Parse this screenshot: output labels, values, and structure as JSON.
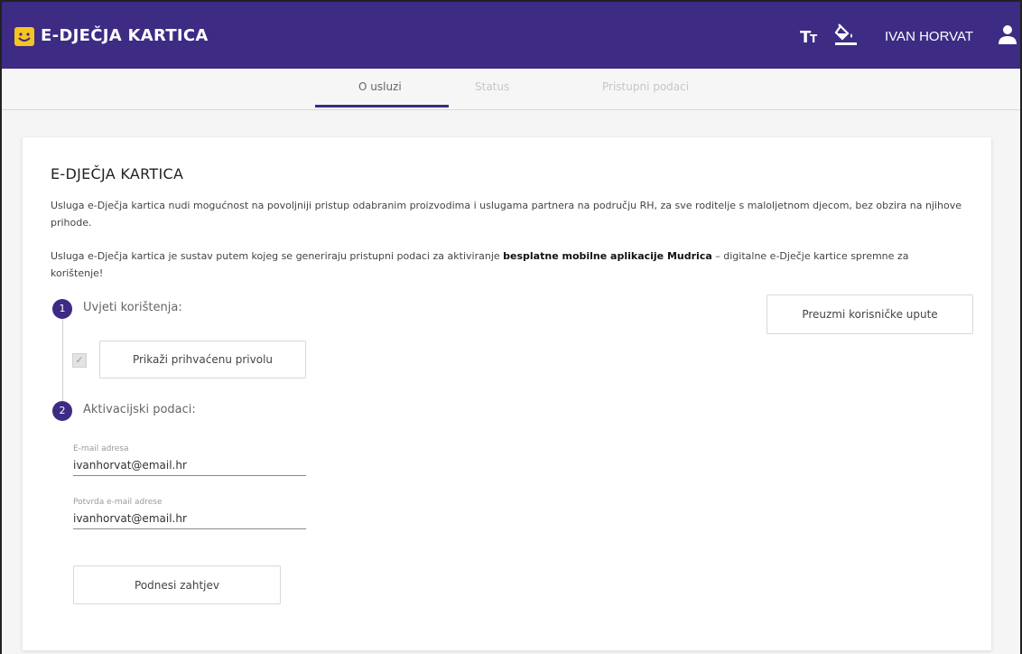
{
  "header": {
    "app_title": "E-DJEČJA KARTICA",
    "user_name": "IVAN HORVAT",
    "icons": [
      "logo-icon",
      "text-size-icon",
      "contrast-paint-icon",
      "user-icon"
    ],
    "brand_color": "#3d2b84",
    "logo_color": "#f6c51f"
  },
  "tabs": [
    {
      "label": "O usluzi",
      "active": true
    },
    {
      "label": "Status",
      "active": false
    },
    {
      "label": "Pristupni podaci",
      "active": false
    }
  ],
  "card": {
    "title": "E-DJEČJA KARTICA",
    "paragraph_1": "Usluga e-Dječja kartica nudi mogućnost na povoljniji pristup odabranim proizvodima i uslugama partnera na području RH, za sve roditelje s maloljetnom djecom, bez obzira na njihove prihode.",
    "paragraph_2_before": "Usluga e-Dječja kartica je sustav putem kojeg se generiraju pristupni podaci za aktiviranje ",
    "paragraph_2_bold": "besplatne mobilne aplikacije Mudrica",
    "paragraph_2_after": " – digitalne e-Dječje kartice spremne za korištenje!",
    "manual_button": "Preuzmi korisničke upute",
    "step_1": {
      "number": "1",
      "label": "Uvjeti korištenja:"
    },
    "consent_button": "Prikaži prihvaćenu privolu",
    "consent_checked": true,
    "step_2": {
      "number": "2",
      "label": "Aktivacijski podaci:"
    },
    "email_label": "E-mail adresa",
    "email_value": "ivanhorvat@email.hr",
    "confirm_label": "Potvrda e-mail adrese",
    "confirm_value": "ivanhorvat@email.hr",
    "submit_button": "Podnesi zahtjev"
  }
}
